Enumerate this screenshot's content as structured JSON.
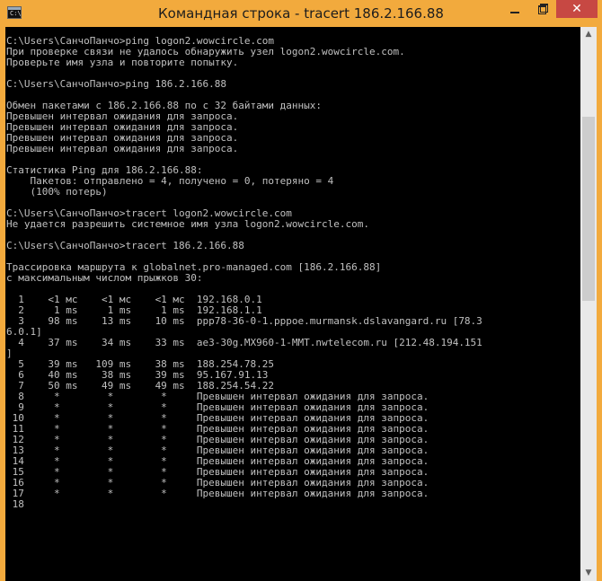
{
  "window": {
    "title": "Командная строка - tracert  186.2.166.88",
    "icon": "command-prompt-icon",
    "icon_text": "C:\\",
    "minimize_icon": "minimize-icon",
    "maximize_icon": "restore-icon",
    "close_glyph": "✕"
  },
  "colors": {
    "titlebar": "#f2aa3d",
    "console_bg": "#000000",
    "console_text": "#c0c0c0",
    "close_button": "#c74843"
  },
  "console": {
    "text": "C:\\Users\\СанчоПанчо>ping logon2.wowcircle.com\nПри проверке связи не удалось обнаружить узел logon2.wowcircle.com.\nПроверьте имя узла и повторите попытку.\n\nC:\\Users\\СанчоПанчо>ping 186.2.166.88\n\nОбмен пакетами с 186.2.166.88 по с 32 байтами данных:\nПревышен интервал ожидания для запроса.\nПревышен интервал ожидания для запроса.\nПревышен интервал ожидания для запроса.\nПревышен интервал ожидания для запроса.\n\nСтатистика Ping для 186.2.166.88:\n    Пакетов: отправлено = 4, получено = 0, потеряно = 4\n    (100% потерь)\n\nC:\\Users\\СанчоПанчо>tracert logon2.wowcircle.com\nНе удается разрешить системное имя узла logon2.wowcircle.com.\n\nC:\\Users\\СанчоПанчо>tracert 186.2.166.88\n\nТрассировка маршрута к globalnet.pro-managed.com [186.2.166.88]\nс максимальным числом прыжков 30:\n\n  1    <1 мс    <1 мс    <1 мс  192.168.0.1\n  2     1 ms     1 ms     1 ms  192.168.1.1\n  3    98 ms    13 ms    10 ms  ppp78-36-0-1.pppoe.murmansk.dslavangard.ru [78.3\n6.0.1]\n  4    37 ms    34 ms    33 ms  ae3-30g.MX960-1-MMT.nwtelecom.ru [212.48.194.151\n]\n  5    39 ms   109 ms    38 ms  188.254.78.25\n  6    40 ms    38 ms    39 ms  95.167.91.13\n  7    50 ms    49 ms    49 ms  188.254.54.22\n  8     *        *        *     Превышен интервал ожидания для запроса.\n  9     *        *        *     Превышен интервал ожидания для запроса.\n 10     *        *        *     Превышен интервал ожидания для запроса.\n 11     *        *        *     Превышен интервал ожидания для запроса.\n 12     *        *        *     Превышен интервал ожидания для запроса.\n 13     *        *        *     Превышен интервал ожидания для запроса.\n 14     *        *        *     Превышен интервал ожидания для запроса.\n 15     *        *        *     Превышен интервал ожидания для запроса.\n 16     *        *        *     Превышен интервал ожидания для запроса.\n 17     *        *        *     Превышен интервал ожидания для запроса.\n 18"
  },
  "scrollbar": {
    "up_glyph": "▲",
    "down_glyph": "▼"
  }
}
